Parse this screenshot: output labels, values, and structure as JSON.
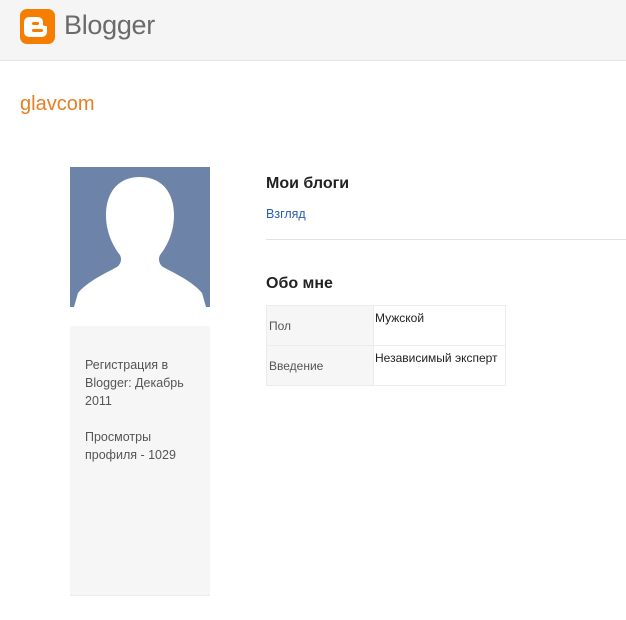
{
  "header": {
    "logo_icon": "blogger-logo-icon",
    "brand": "Blogger",
    "brand_color": "#f57d00"
  },
  "profile": {
    "username": "glavcom",
    "avatar_icon": "default-avatar-silhouette-icon",
    "registration": "Регистрация в Blogger: Декабрь 2011",
    "views": "Просмотры профиля - 1029"
  },
  "blogs": {
    "title": "Мои блоги",
    "items": [
      {
        "label": "Взгляд"
      }
    ]
  },
  "about": {
    "title": "Обо мне",
    "rows": [
      {
        "key": "Пол",
        "value": "Мужской"
      },
      {
        "key": "Введение",
        "value": "Независимый эксперт"
      }
    ]
  }
}
